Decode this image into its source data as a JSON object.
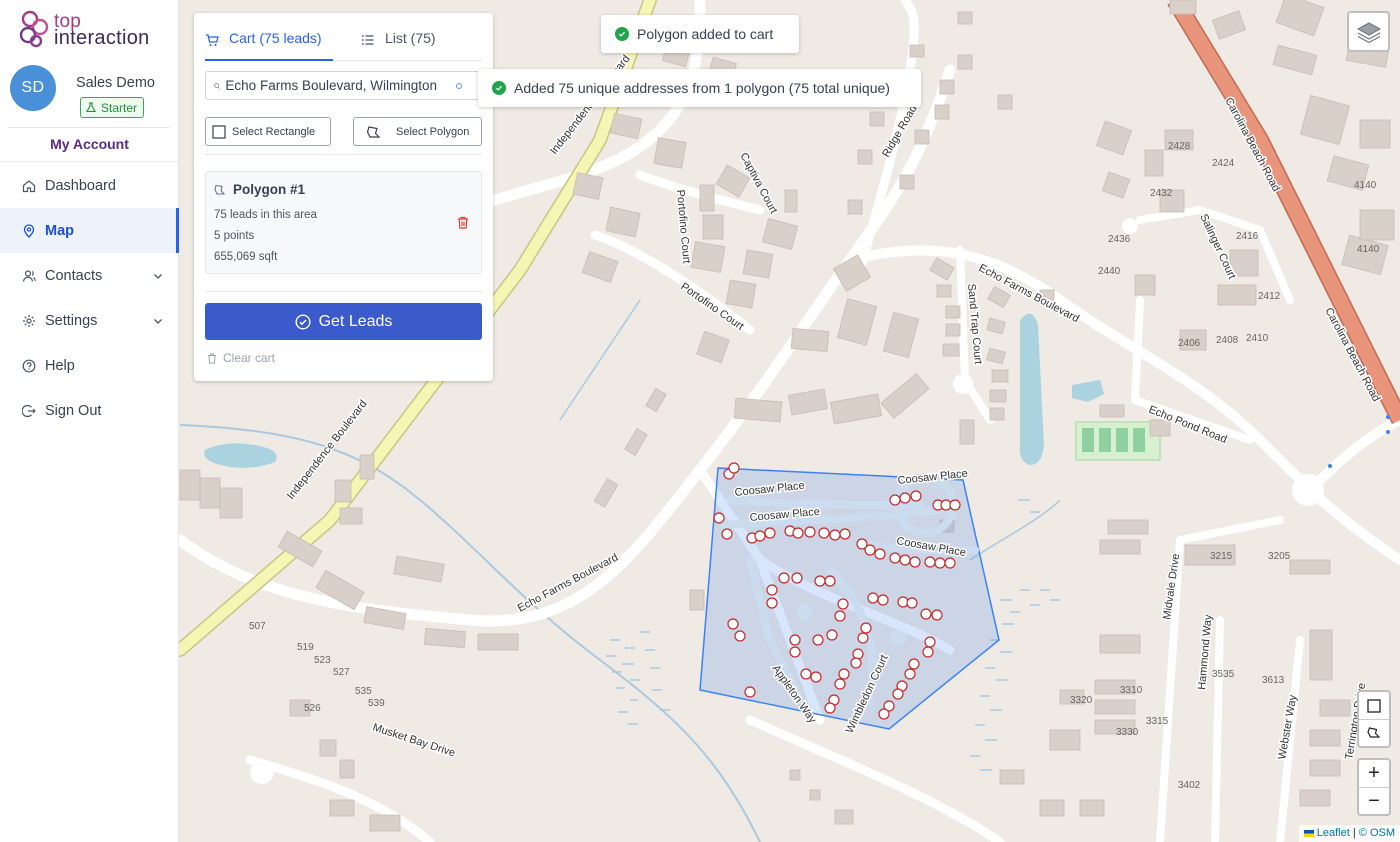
{
  "logo": {
    "line1": "top",
    "line2": "interaction"
  },
  "profile": {
    "initials": "SD",
    "name": "Sales Demo",
    "plan": "Starter"
  },
  "my_account": "My Account",
  "nav": [
    {
      "label": "Dashboard",
      "icon": "home-icon"
    },
    {
      "label": "Map",
      "icon": "map-pin-icon",
      "active": true
    },
    {
      "label": "Contacts",
      "icon": "contacts-icon",
      "expandable": true
    },
    {
      "label": "Settings",
      "icon": "gear-icon",
      "expandable": true
    },
    {
      "label": "Help",
      "icon": "help-icon"
    },
    {
      "label": "Sign Out",
      "icon": "sign-out-icon"
    }
  ],
  "panel": {
    "tab_cart": "Cart (75 leads)",
    "tab_list": "List (75)",
    "search_value": "Echo Farms Boulevard, Wilmington",
    "select_rectangle": "Select Rectangle",
    "select_polygon": "Select Polygon",
    "polygon": {
      "title": "Polygon #1",
      "leads": "75 leads in this area",
      "points": "5 points",
      "area": "655,069 sqft"
    },
    "get_leads": "Get Leads",
    "clear_cart": "Clear cart"
  },
  "toasts": {
    "first": "Polygon added to cart",
    "second": "Added 75 unique addresses from 1 polygon (75 total unique)"
  },
  "map_labels": {
    "independence_blvd": "Independence Boulevard",
    "carolina_beach_rd": "Carolina Beach Road",
    "echo_farms_blvd": "Echo Farms Boulevard",
    "echo_pond_rd": "Echo Pond Road",
    "captiva_court": "Captiva Court",
    "portofino_court": "Portofino Court",
    "ridge_road": "Ridge Road",
    "sand_trap_court": "Sand Trap Court",
    "salinger_court": "Salinger Court",
    "coosaw_place": "Coosaw Place",
    "appleton_way": "Appleton Way",
    "wimbledon_court": "Wimbledon Court",
    "musket_bay_drive": "Musket Bay Drive",
    "midvale_drive": "Midvale Drive",
    "hammond_way": "Hammond Way",
    "webster_way": "Webster Way",
    "terrington_drive": "Terrington Drive"
  },
  "house_numbers": [
    "2428",
    "2424",
    "4140",
    "2432",
    "2436",
    "2416",
    "4140",
    "2440",
    "2412",
    "2406",
    "2408",
    "2410",
    "3215",
    "3205",
    "3535",
    "3613",
    "3320",
    "3310",
    "3315",
    "3330",
    "3402",
    "507",
    "519",
    "523",
    "527",
    "535",
    "539",
    "526"
  ],
  "map_controls": {
    "zoom_in": "+",
    "zoom_out": "−"
  },
  "attribution": {
    "leaflet": "Leaflet",
    "sep": "|",
    "osm": "© OSM"
  },
  "colors": {
    "accent": "#2563eb",
    "button": "#3b5bcc",
    "polygon": "#3b82f6",
    "marker": "#d32f2f",
    "primary_road": "#e8957b",
    "secondary_road": "#f6f6b4"
  }
}
